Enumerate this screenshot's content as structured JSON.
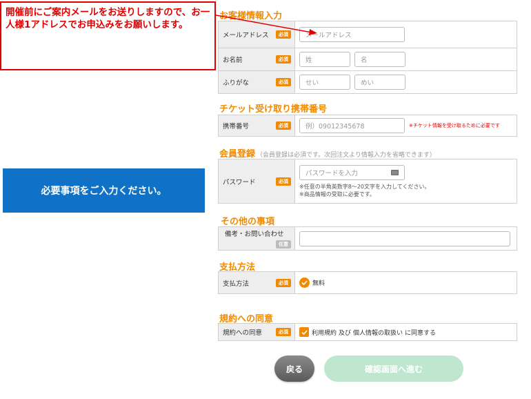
{
  "annotation": {
    "callout_text": "開催前にご案内メールをお送りしますので、お一人様1アドレスでお申込みをお願いします。",
    "blue_box_text": "必要事項をご入力ください。",
    "accent_red": "#e00000",
    "accent_blue": "#0f72c6"
  },
  "colors": {
    "accent_orange": "#f08a00",
    "button_grey": "#6e6e6e",
    "button_disabled_green": "#bfe7cf"
  },
  "required_badge": "必須",
  "optional_badge": "任意",
  "customer": {
    "title": "お客様情報入力",
    "email_label": "メールアドレス",
    "email_placeholder": "メールアドレス",
    "name_label": "お名前",
    "last_name_placeholder": "姓",
    "first_name_placeholder": "名",
    "kana_label": "ふりがな",
    "last_kana_placeholder": "せい",
    "first_kana_placeholder": "めい"
  },
  "ticket": {
    "title": "チケット受け取り携帯番号",
    "phone_label": "携帯番号",
    "phone_placeholder": "例）09012345678",
    "phone_note": "※チケット情報を受け取るために必要です"
  },
  "member": {
    "title": "会員登録",
    "title_note": "（会員登録は必須です。次回注文より情報入力を省略できます）",
    "password_label": "パスワード",
    "password_placeholder": "パスワードを入力",
    "password_note_1": "※任意の半角英数字8～20文字を入力してください。",
    "password_note_2": "※商品情報の受取に必要です。"
  },
  "other": {
    "title": "その他の事項",
    "remarks_label": "備考・お問い合わせ"
  },
  "payment": {
    "title": "支払方法",
    "method_label": "支払方法",
    "method_value": "無料"
  },
  "terms": {
    "title": "規約への同意",
    "agree_label": "規約への同意",
    "terms_link": "利用規約",
    "and_text": "及び",
    "privacy_link": "個人情報の取扱い",
    "agree_text": "に同意する"
  },
  "buttons": {
    "back": "戻る",
    "next": "確認画面へ進む"
  }
}
